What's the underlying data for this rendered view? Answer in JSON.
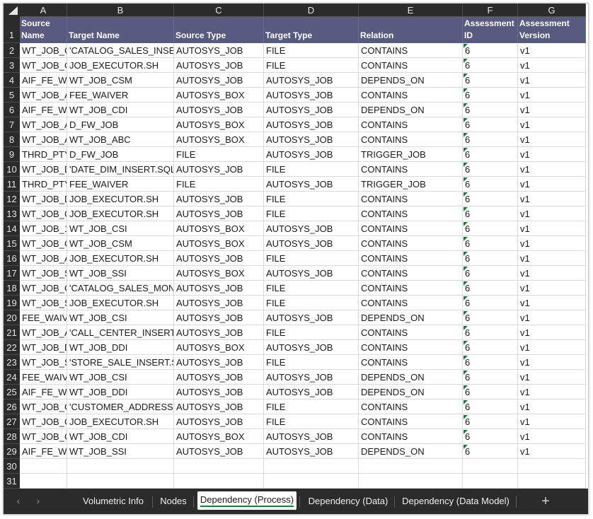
{
  "columns": [
    "A",
    "B",
    "C",
    "D",
    "E",
    "F",
    "G"
  ],
  "row_numbers": [
    "1",
    "2",
    "3",
    "4",
    "5",
    "6",
    "7",
    "8",
    "9",
    "10",
    "11",
    "12",
    "13",
    "14",
    "15",
    "16",
    "17",
    "18",
    "19",
    "20",
    "21",
    "22",
    "23",
    "24",
    "25",
    "26",
    "27",
    "28",
    "29",
    "30",
    "31"
  ],
  "header": [
    [
      "Source",
      "Name"
    ],
    [
      "",
      "Target Name"
    ],
    [
      "",
      "Source Type"
    ],
    [
      "",
      "Target Type"
    ],
    [
      "",
      "Relation"
    ],
    [
      "Assessment",
      "ID"
    ],
    [
      "Assessment",
      "Version"
    ]
  ],
  "rows": [
    [
      "WT_JOB_C",
      "'CATALOG_SALES_INSEI",
      "AUTOSYS_JOB",
      "FILE",
      "CONTAINS",
      "6",
      "v1"
    ],
    [
      "WT_JOB_C",
      "JOB_EXECUTOR.SH",
      "AUTOSYS_JOB",
      "FILE",
      "CONTAINS",
      "6",
      "v1"
    ],
    [
      "AIF_FE_W/",
      "WT_JOB_CSM",
      "AUTOSYS_JOB",
      "AUTOSYS_JOB",
      "DEPENDS_ON",
      "6",
      "v1"
    ],
    [
      "WT_JOB_A",
      "FEE_WAIVER",
      "AUTOSYS_BOX",
      "AUTOSYS_JOB",
      "CONTAINS",
      "6",
      "v1"
    ],
    [
      "AIF_FE_W/",
      "WT_JOB_CDI",
      "AUTOSYS_JOB",
      "AUTOSYS_JOB",
      "DEPENDS_ON",
      "6",
      "v1"
    ],
    [
      "WT_JOB_A",
      "D_FW_JOB",
      "AUTOSYS_BOX",
      "AUTOSYS_JOB",
      "CONTAINS",
      "6",
      "v1"
    ],
    [
      "WT_JOB_A",
      "WT_JOB_ABC",
      "AUTOSYS_BOX",
      "AUTOSYS_JOB",
      "CONTAINS",
      "6",
      "v1"
    ],
    [
      "THRD_PTY",
      "D_FW_JOB",
      "FILE",
      "AUTOSYS_JOB",
      "TRIGGER_JOB",
      "6",
      "v1"
    ],
    [
      "WT_JOB_D",
      "'DATE_DIM_INSERT.SQL",
      "AUTOSYS_JOB",
      "FILE",
      "CONTAINS",
      "6",
      "v1"
    ],
    [
      "THRD_PTY",
      "FEE_WAIVER",
      "FILE",
      "AUTOSYS_JOB",
      "TRIGGER_JOB",
      "6",
      "v1"
    ],
    [
      "WT_JOB_D",
      "JOB_EXECUTOR.SH",
      "AUTOSYS_JOB",
      "FILE",
      "CONTAINS",
      "6",
      "v1"
    ],
    [
      "WT_JOB_C",
      "JOB_EXECUTOR.SH",
      "AUTOSYS_JOB",
      "FILE",
      "CONTAINS",
      "6",
      "v1"
    ],
    [
      "WT_JOB_1",
      "WT_JOB_CSI",
      "AUTOSYS_BOX",
      "AUTOSYS_JOB",
      "CONTAINS",
      "6",
      "v1"
    ],
    [
      "WT_JOB_C",
      "WT_JOB_CSM",
      "AUTOSYS_BOX",
      "AUTOSYS_JOB",
      "CONTAINS",
      "6",
      "v1"
    ],
    [
      "WT_JOB_A",
      "JOB_EXECUTOR.SH",
      "AUTOSYS_JOB",
      "FILE",
      "CONTAINS",
      "6",
      "v1"
    ],
    [
      "WT_JOB_S",
      "WT_JOB_SSI",
      "AUTOSYS_BOX",
      "AUTOSYS_JOB",
      "CONTAINS",
      "6",
      "v1"
    ],
    [
      "WT_JOB_C",
      "'CATALOG_SALES_MON",
      "AUTOSYS_JOB",
      "FILE",
      "CONTAINS",
      "6",
      "v1"
    ],
    [
      "WT_JOB_S",
      "JOB_EXECUTOR.SH",
      "AUTOSYS_JOB",
      "FILE",
      "CONTAINS",
      "6",
      "v1"
    ],
    [
      "FEE_WAIV",
      "WT_JOB_CSI",
      "AUTOSYS_JOB",
      "AUTOSYS_JOB",
      "DEPENDS_ON",
      "6",
      "v1"
    ],
    [
      "WT_JOB_A",
      "'CALL_CENTER_INSERT.",
      "AUTOSYS_JOB",
      "FILE",
      "CONTAINS",
      "6",
      "v1"
    ],
    [
      "WT_JOB_D",
      "WT_JOB_DDI",
      "AUTOSYS_BOX",
      "AUTOSYS_JOB",
      "CONTAINS",
      "6",
      "v1"
    ],
    [
      "WT_JOB_S",
      "'STORE_SALE_INSERT.S(",
      "AUTOSYS_JOB",
      "FILE",
      "CONTAINS",
      "6",
      "v1"
    ],
    [
      "FEE_WAIV",
      "WT_JOB_CSI",
      "AUTOSYS_JOB",
      "AUTOSYS_JOB",
      "DEPENDS_ON",
      "6",
      "v1"
    ],
    [
      "AIF_FE_W/",
      "WT_JOB_DDI",
      "AUTOSYS_JOB",
      "AUTOSYS_JOB",
      "DEPENDS_ON",
      "6",
      "v1"
    ],
    [
      "WT_JOB_C",
      "'CUSTOMER_ADDRESS_",
      "AUTOSYS_JOB",
      "FILE",
      "CONTAINS",
      "6",
      "v1"
    ],
    [
      "WT_JOB_C",
      "JOB_EXECUTOR.SH",
      "AUTOSYS_JOB",
      "FILE",
      "CONTAINS",
      "6",
      "v1"
    ],
    [
      "WT_JOB_C",
      "WT_JOB_CDI",
      "AUTOSYS_BOX",
      "AUTOSYS_JOB",
      "CONTAINS",
      "6",
      "v1"
    ],
    [
      "AIF_FE_W/",
      "WT_JOB_SSI",
      "AUTOSYS_JOB",
      "AUTOSYS_JOB",
      "DEPENDS_ON",
      "6",
      "v1"
    ]
  ],
  "tabs": [
    {
      "label": "Volumetric Info",
      "active": false
    },
    {
      "label": "Nodes",
      "active": false
    },
    {
      "label": "Dependency (Process)",
      "active": true
    },
    {
      "label": "Dependency (Data)",
      "active": false
    },
    {
      "label": "Dependency (Data Model)",
      "active": false
    }
  ],
  "nav": {
    "prev": "‹",
    "next": "›",
    "add": "+"
  },
  "colors": {
    "header_fill": "#595a80",
    "grid_dark": "#2b2b2b",
    "error_marker": "#1e7a34"
  }
}
